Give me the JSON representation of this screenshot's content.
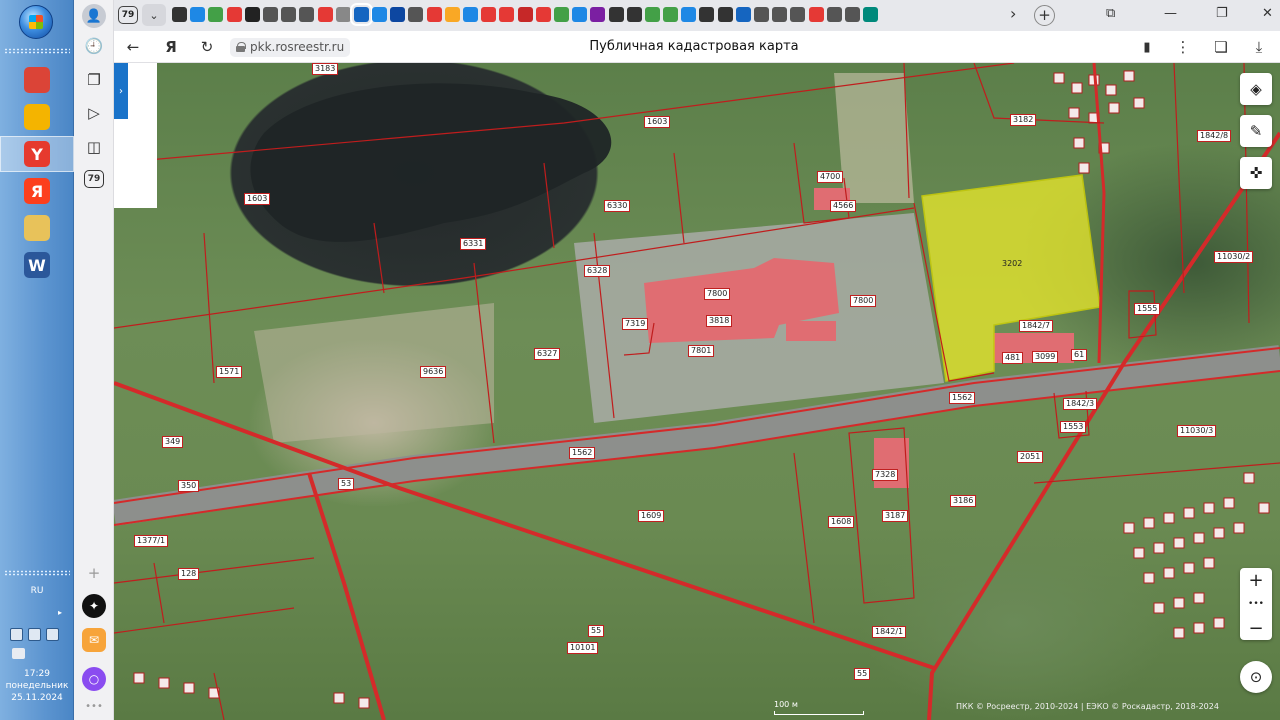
{
  "taskbar": {
    "lang": "RU",
    "time": "17:29",
    "weekday": "понедельник",
    "date": "25.11.2024",
    "apps": [
      {
        "name": "chrome-icon",
        "color": "#db4437",
        "glyph": ""
      },
      {
        "name": "sticky-notes-icon",
        "color": "#f4b400",
        "glyph": ""
      },
      {
        "name": "yandex-browser-icon",
        "color": "#e63a2e",
        "glyph": "Y"
      },
      {
        "name": "yandex-icon",
        "color": "#fc3f1d",
        "glyph": "Я"
      },
      {
        "name": "file-explorer-icon",
        "color": "#e8c25a",
        "glyph": ""
      },
      {
        "name": "word-icon",
        "color": "#2b579a",
        "glyph": "W"
      }
    ]
  },
  "browser": {
    "tab_count": "79",
    "sidebar_badge": "79",
    "url": "pkk.rosreestr.ru",
    "title": "Публичная кадастровая карта",
    "favicon_colors": [
      "#333333",
      "#1e88e5",
      "#43a047",
      "#e53935",
      "#222222",
      "#555555",
      "#555555",
      "#555555",
      "#e53935",
      "#888888",
      "#1565c0",
      "#1e88e5",
      "#0d47a1",
      "#555555",
      "#e53935",
      "#f9a825",
      "#1e88e5",
      "#e53935",
      "#e53935",
      "#c62828",
      "#e53935",
      "#43a047",
      "#1e88e5",
      "#7b1fa2",
      "#333333",
      "#333333",
      "#43a047",
      "#43a047",
      "#1e88e5",
      "#333333",
      "#333333",
      "#1565c0",
      "#555555",
      "#555555",
      "#555555",
      "#e53935",
      "#555555",
      "#555555",
      "#00897b"
    ]
  },
  "map": {
    "labels": [
      {
        "text": "3183"
      },
      {
        "text": "1603"
      },
      {
        "text": "1603"
      },
      {
        "text": "4700"
      },
      {
        "text": "4566"
      },
      {
        "text": "6330"
      },
      {
        "text": "6331"
      },
      {
        "text": "6328"
      },
      {
        "text": "7800"
      },
      {
        "text": "3818"
      },
      {
        "text": "7800"
      },
      {
        "text": "7801"
      },
      {
        "text": "7319"
      },
      {
        "text": "6327"
      },
      {
        "text": "9636"
      },
      {
        "text": "1571"
      },
      {
        "text": "3202"
      },
      {
        "text": "1842/7"
      },
      {
        "text": "481"
      },
      {
        "text": "3099"
      },
      {
        "text": "1562"
      },
      {
        "text": "1562"
      },
      {
        "text": "53"
      },
      {
        "text": "349"
      },
      {
        "text": "350"
      },
      {
        "text": "1609"
      },
      {
        "text": "1608"
      },
      {
        "text": "3187"
      },
      {
        "text": "3186"
      },
      {
        "text": "2051"
      },
      {
        "text": "1553"
      },
      {
        "text": "1842/3"
      },
      {
        "text": "11030/3"
      },
      {
        "text": "11030/2"
      },
      {
        "text": "1842/8"
      },
      {
        "text": "3182"
      },
      {
        "text": "128"
      },
      {
        "text": "10101"
      },
      {
        "text": "55"
      },
      {
        "text": "55"
      },
      {
        "text": "1842/1"
      },
      {
        "text": "1555"
      },
      {
        "text": "1377/1"
      },
      {
        "text": "7328"
      },
      {
        "text": "61"
      }
    ],
    "scale": "100 м",
    "attribution": "ПКК © Росреестр, 2010-2024 | ЕЭКО © Роскадастр, 2018-2024",
    "zoom_in": "+",
    "zoom_out": "−",
    "zoom_dots": "•••"
  }
}
